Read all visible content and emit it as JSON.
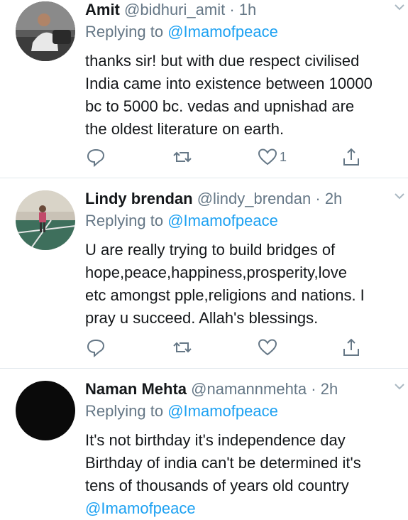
{
  "tweets": [
    {
      "name": "Amit",
      "handle": "@bidhuri_amit",
      "time": "· 1h",
      "replying_prefix": "Replying to ",
      "replying_to": "@Imamofpeace",
      "lines": [
        "thanks sir! but with due respect civilised",
        "India came into existence between 10000",
        "bc to 5000 bc. vedas and upnishad are",
        "the oldest literature on earth."
      ],
      "like_count": "1",
      "avatar_icon": "man-in-car-photo"
    },
    {
      "name": "Lindy brendan",
      "handle": "@lindy_brendan",
      "time": "· 2h",
      "replying_prefix": "Replying to ",
      "replying_to": "@Imamofpeace",
      "lines": [
        "U are really trying to build bridges of",
        "hope,peace,happiness,prosperity,love",
        "etc amongst pple,religions and nations. I",
        "pray u succeed. Allah's blessings."
      ],
      "like_count": "",
      "avatar_icon": "tennis-court-photo"
    },
    {
      "name": "Naman Mehta",
      "handle": "@namannmehta",
      "time": "· 2h",
      "replying_prefix": "Replying to ",
      "replying_to": "@Imamofpeace",
      "lines": [
        "It's not birthday it's independence day",
        "Birthday of india can't be determined it's",
        "tens of thousands of years old country"
      ],
      "mention_line": "@Imamofpeace",
      "avatar_icon": "black-avatar"
    }
  ],
  "colors": {
    "accent": "#1da1f2",
    "muted": "#657786",
    "text": "#14171a",
    "divider": "#e1e8ed"
  }
}
